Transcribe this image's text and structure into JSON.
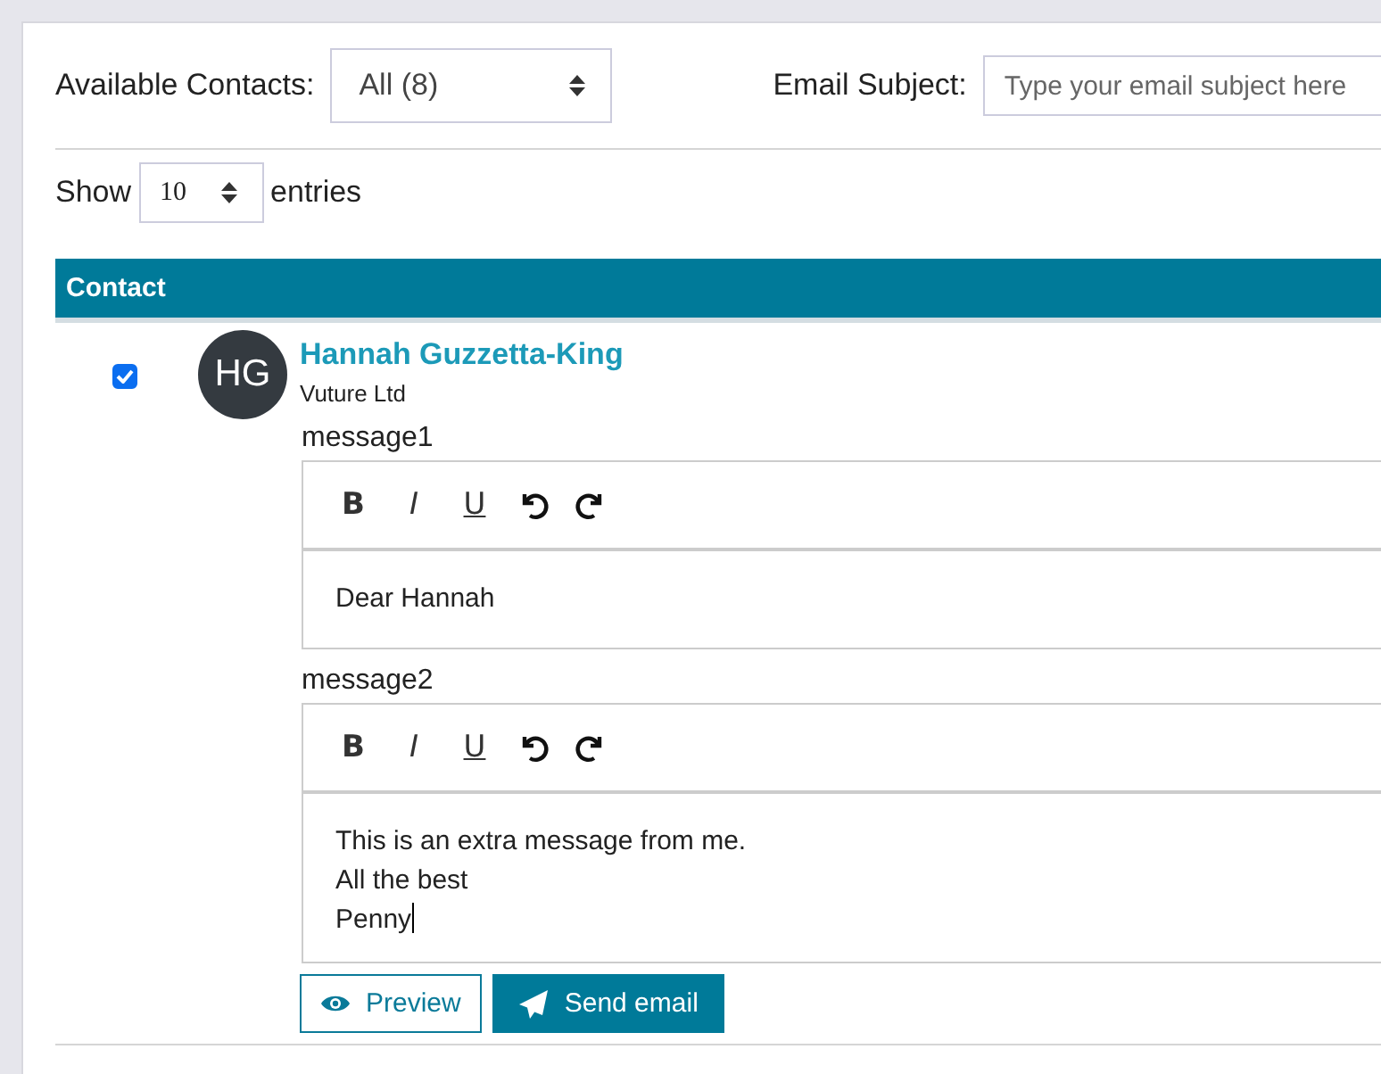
{
  "filters": {
    "contacts_label": "Available Contacts:",
    "contacts_value": "All (8)",
    "subject_label": "Email Subject:",
    "subject_placeholder": "Type your email subject here"
  },
  "length": {
    "show": "Show",
    "value": "10",
    "entries": "entries"
  },
  "table": {
    "columns": [
      "Contact"
    ],
    "rows": [
      {
        "checked": true,
        "initials": "HG",
        "name": "Hannah Guzzetta-King",
        "company": "Vuture Ltd",
        "editors": [
          {
            "label": "message1",
            "focused": false,
            "toolbar": [
              {
                "kind": "bold",
                "label": "B"
              },
              {
                "kind": "italic",
                "label": "I"
              },
              {
                "kind": "underline",
                "label": "U"
              },
              {
                "kind": "undo"
              },
              {
                "kind": "redo"
              }
            ],
            "lines": [
              "Dear Hannah"
            ]
          },
          {
            "label": "message2",
            "focused": true,
            "toolbar": [
              {
                "kind": "bold",
                "label": "B"
              },
              {
                "kind": "italic",
                "label": "I"
              },
              {
                "kind": "underline",
                "label": "U"
              },
              {
                "kind": "undo"
              },
              {
                "kind": "redo"
              }
            ],
            "lines": [
              "This is an extra message from me.",
              "All the best",
              "Penny"
            ]
          }
        ],
        "buttons": [
          {
            "kind": "preview",
            "label": "Preview"
          },
          {
            "kind": "send",
            "label": "Send email"
          }
        ]
      }
    ]
  }
}
